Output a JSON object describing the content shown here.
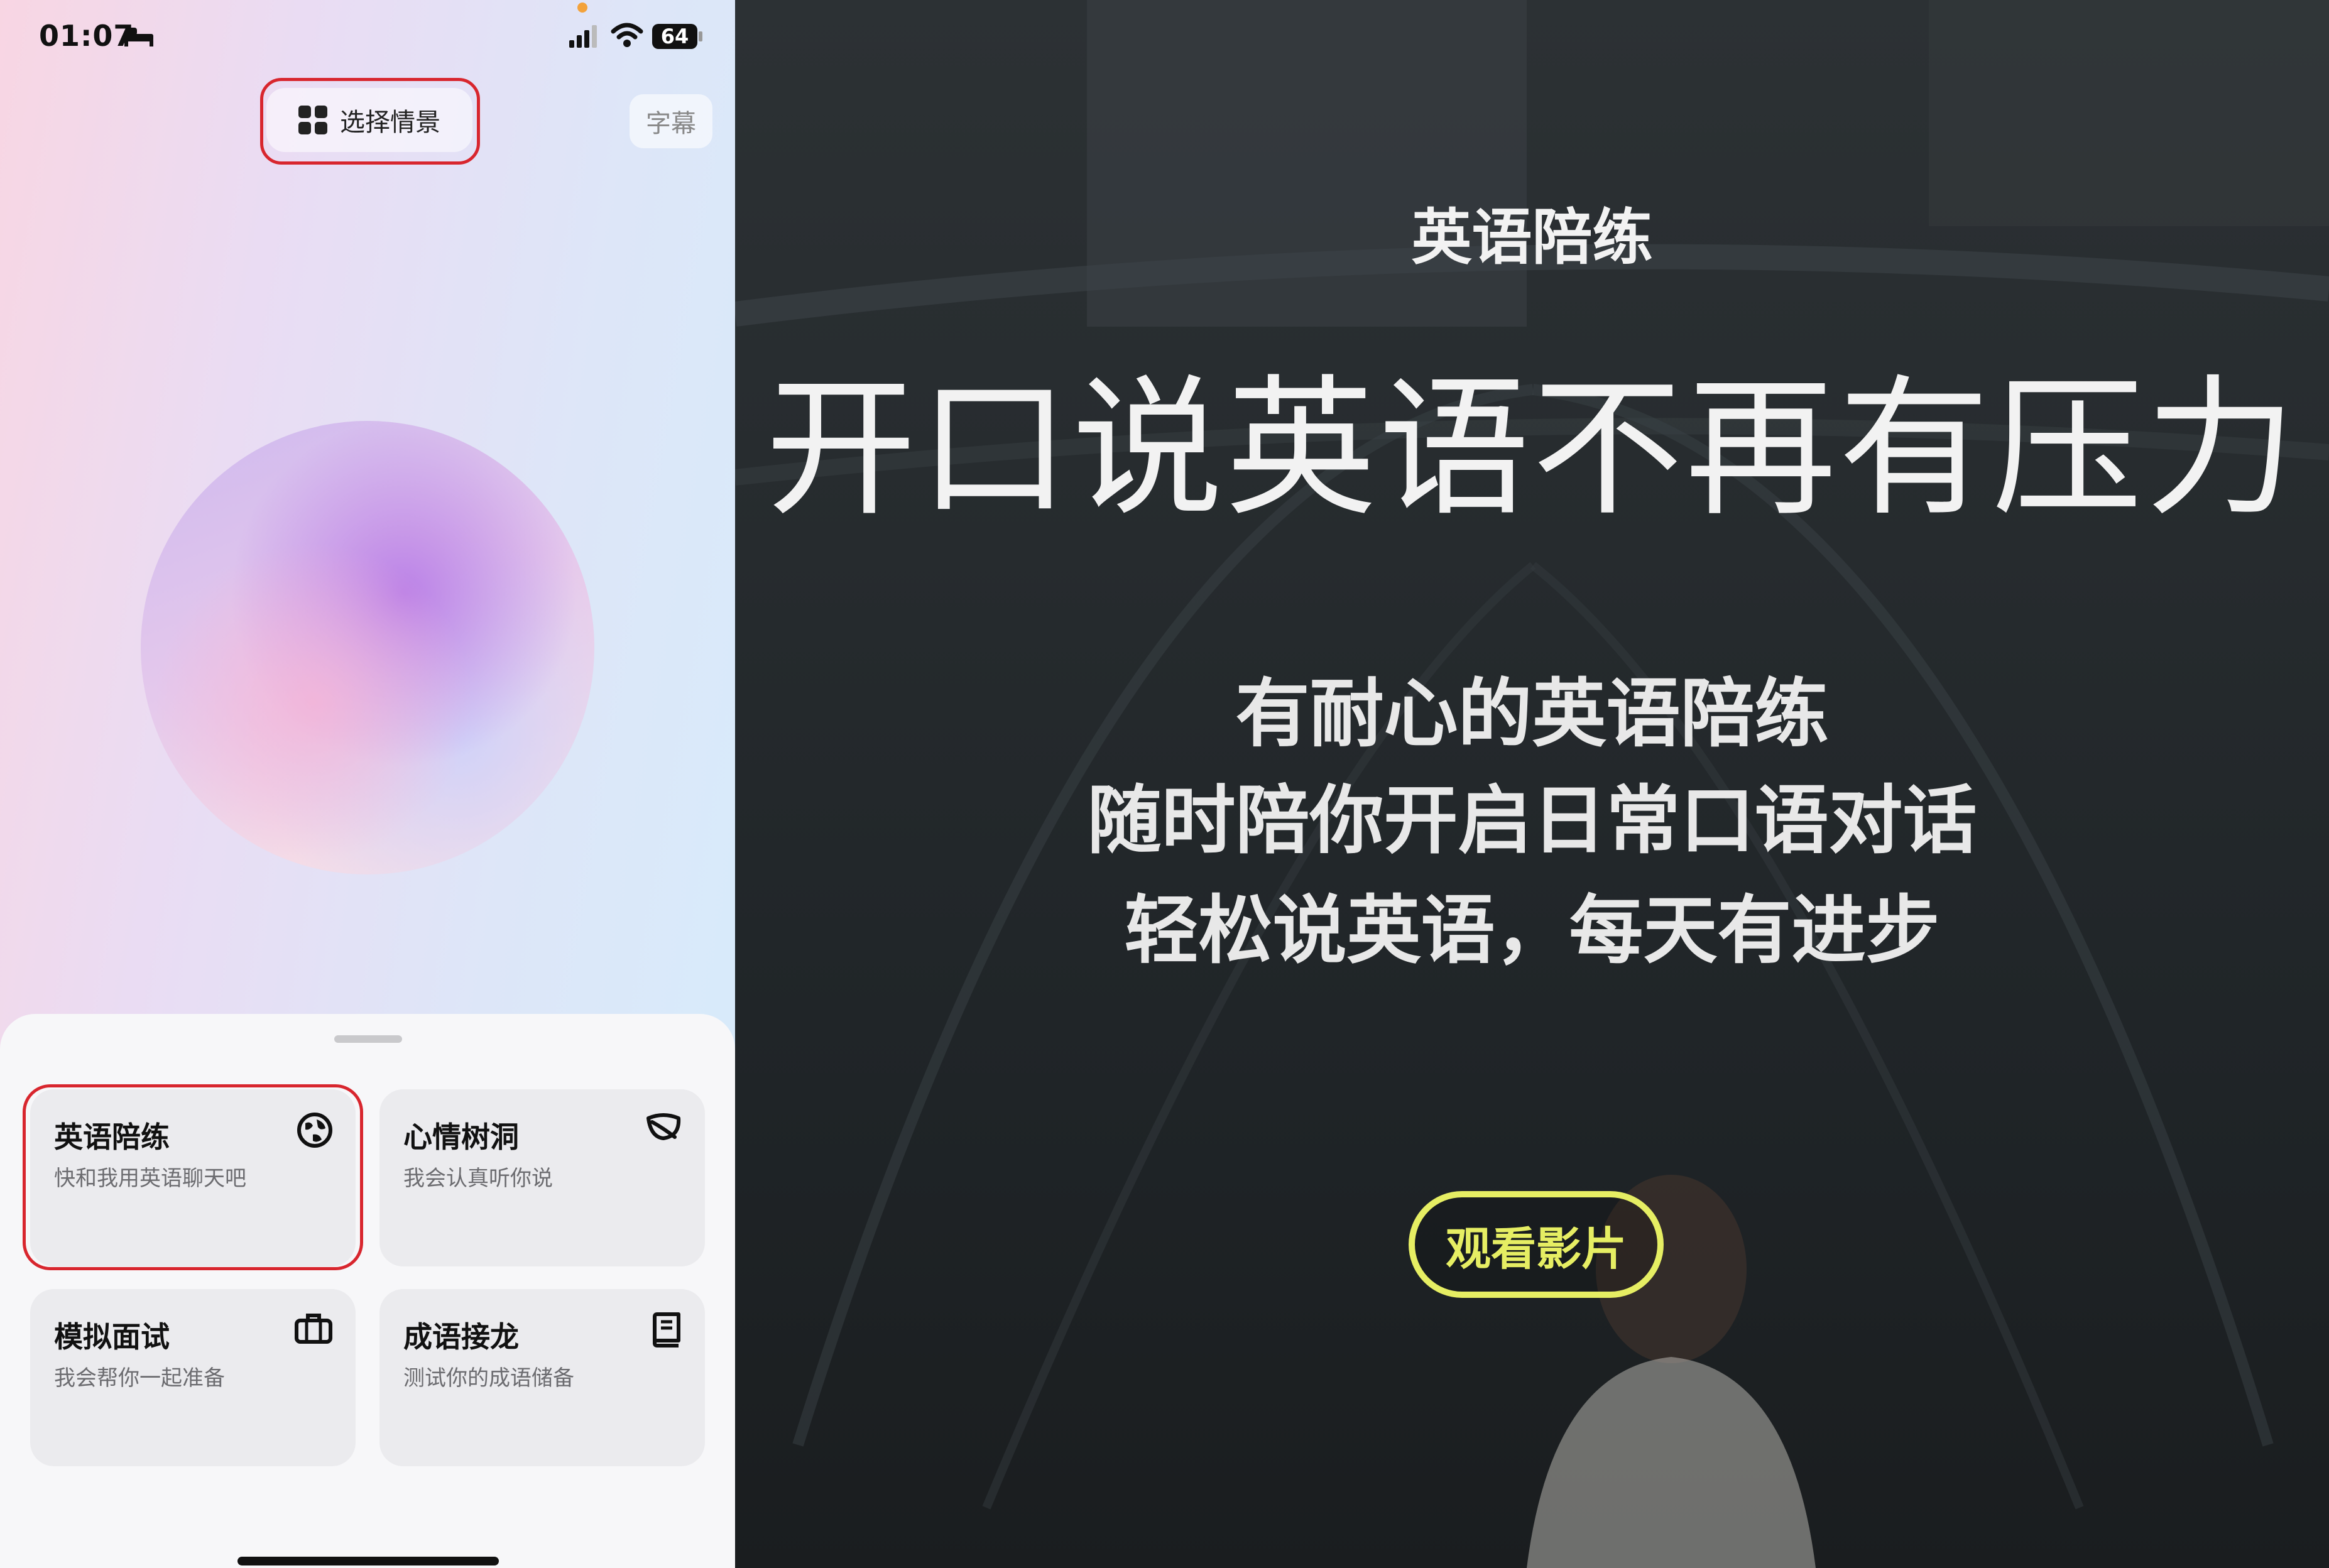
{
  "status_bar": {
    "time": "01:07",
    "battery": "64",
    "icons": [
      "bed-icon",
      "signal-icon",
      "wifi-icon",
      "battery-icon"
    ]
  },
  "header": {
    "scene_button_label": "选择情景",
    "scene_button_icon": "grid-icon",
    "subtitle_label": "字幕"
  },
  "cards": [
    {
      "title": "英语陪练",
      "subtitle": "快和我用英语聊天吧",
      "icon": "globe-icon"
    },
    {
      "title": "心情树洞",
      "subtitle": "我会认真听你说",
      "icon": "leaf-icon"
    },
    {
      "title": "模拟面试",
      "subtitle": "我会帮你一起准备",
      "icon": "briefcase-icon"
    },
    {
      "title": "成语接龙",
      "subtitle": "测试你的成语储备",
      "icon": "book-icon"
    }
  ],
  "video": {
    "kicker": "英语陪练",
    "headline": "开口说英语不再有压力",
    "lines": [
      "有耐心的英语陪练",
      "随时陪你开启日常口语对话",
      "轻松说英语，每天有进步"
    ],
    "button_label": "观看影片"
  },
  "colors": {
    "highlight": "#d8262e",
    "video_button": "#e6ee63"
  }
}
